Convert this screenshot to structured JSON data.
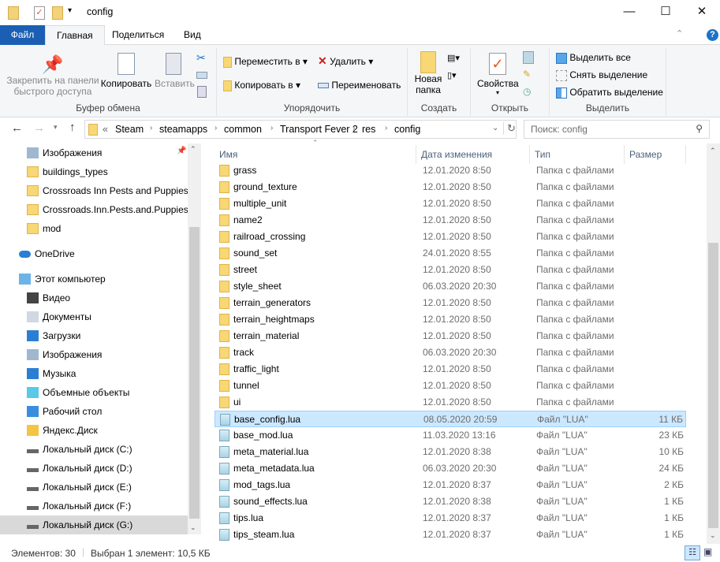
{
  "window": {
    "title": "config",
    "minimize": "—",
    "maximize": "☐",
    "close": "✕"
  },
  "tabs": [
    "Файл",
    "Главная",
    "Поделиться",
    "Вид"
  ],
  "ribbon": {
    "clipboard": {
      "pin": "Закрепить на панели быстрого доступа",
      "pin1": "Закрепить на панели",
      "pin2": "быстрого доступа",
      "copy": "Копировать",
      "paste": "Вставить",
      "label": "Буфер обмена"
    },
    "organize": {
      "move": "Переместить в",
      "copy_to": "Копировать в",
      "delete": "Удалить",
      "rename": "Переименовать",
      "label": "Упорядочить"
    },
    "create": {
      "new1": "Новая",
      "new2": "папка",
      "label": "Создать"
    },
    "open": {
      "props": "Свойства",
      "label": "Открыть"
    },
    "select": {
      "all": "Выделить все",
      "none": "Снять выделение",
      "invert": "Обратить выделение",
      "label": "Выделить"
    }
  },
  "address": {
    "overflow": "«",
    "crumbs": [
      "Steam",
      "steamapps",
      "common",
      "Transport Fever 2",
      "res",
      "config"
    ],
    "search_placeholder": "Поиск: config"
  },
  "nav": [
    {
      "label": "Изображения",
      "icon": "pictures"
    },
    {
      "label": "buildings_types",
      "icon": "folder"
    },
    {
      "label": "Crossroads Inn Pests and Puppies",
      "icon": "folder"
    },
    {
      "label": "Crossroads.Inn.Pests.and.Puppies-CODEX",
      "icon": "folder"
    },
    {
      "label": "mod",
      "icon": "folder"
    },
    {
      "label": "OneDrive",
      "icon": "cloud"
    },
    {
      "label": "Этот компьютер",
      "icon": "computer"
    },
    {
      "label": "Видео",
      "icon": "video"
    },
    {
      "label": "Документы",
      "icon": "documents"
    },
    {
      "label": "Загрузки",
      "icon": "downloads"
    },
    {
      "label": "Изображения",
      "icon": "pictures"
    },
    {
      "label": "Музыка",
      "icon": "music"
    },
    {
      "label": "Объемные объекты",
      "icon": "3d"
    },
    {
      "label": "Рабочий стол",
      "icon": "desktop"
    },
    {
      "label": "Яндекс.Диск",
      "icon": "yadisk"
    },
    {
      "label": "Локальный диск (C:)",
      "icon": "drive"
    },
    {
      "label": "Локальный диск (D:)",
      "icon": "drive"
    },
    {
      "label": "Локальный диск (E:)",
      "icon": "drive"
    },
    {
      "label": "Локальный диск (F:)",
      "icon": "drive"
    },
    {
      "label": "Локальный диск (G:)",
      "icon": "drive",
      "selected": true
    }
  ],
  "columns": [
    "Имя",
    "Дата изменения",
    "Тип",
    "Размер"
  ],
  "files": [
    {
      "name": "grass",
      "date": "12.01.2020 8:50",
      "type": "Папка с файлами",
      "size": ""
    },
    {
      "name": "ground_texture",
      "date": "12.01.2020 8:50",
      "type": "Папка с файлами",
      "size": ""
    },
    {
      "name": "multiple_unit",
      "date": "12.01.2020 8:50",
      "type": "Папка с файлами",
      "size": ""
    },
    {
      "name": "name2",
      "date": "12.01.2020 8:50",
      "type": "Папка с файлами",
      "size": ""
    },
    {
      "name": "railroad_crossing",
      "date": "12.01.2020 8:50",
      "type": "Папка с файлами",
      "size": ""
    },
    {
      "name": "sound_set",
      "date": "24.01.2020 8:55",
      "type": "Папка с файлами",
      "size": ""
    },
    {
      "name": "street",
      "date": "12.01.2020 8:50",
      "type": "Папка с файлами",
      "size": ""
    },
    {
      "name": "style_sheet",
      "date": "06.03.2020 20:30",
      "type": "Папка с файлами",
      "size": ""
    },
    {
      "name": "terrain_generators",
      "date": "12.01.2020 8:50",
      "type": "Папка с файлами",
      "size": ""
    },
    {
      "name": "terrain_heightmaps",
      "date": "12.01.2020 8:50",
      "type": "Папка с файлами",
      "size": ""
    },
    {
      "name": "terrain_material",
      "date": "12.01.2020 8:50",
      "type": "Папка с файлами",
      "size": ""
    },
    {
      "name": "track",
      "date": "06.03.2020 20:30",
      "type": "Папка с файлами",
      "size": ""
    },
    {
      "name": "traffic_light",
      "date": "12.01.2020 8:50",
      "type": "Папка с файлами",
      "size": ""
    },
    {
      "name": "tunnel",
      "date": "12.01.2020 8:50",
      "type": "Папка с файлами",
      "size": ""
    },
    {
      "name": "ui",
      "date": "12.01.2020 8:50",
      "type": "Папка с файлами",
      "size": ""
    },
    {
      "name": "base_config.lua",
      "date": "08.05.2020 20:59",
      "type": "Файл \"LUA\"",
      "size": "11 КБ",
      "selected": true
    },
    {
      "name": "base_mod.lua",
      "date": "11.03.2020 13:16",
      "type": "Файл \"LUA\"",
      "size": "23 КБ"
    },
    {
      "name": "meta_material.lua",
      "date": "12.01.2020 8:38",
      "type": "Файл \"LUA\"",
      "size": "10 КБ"
    },
    {
      "name": "meta_metadata.lua",
      "date": "06.03.2020 20:30",
      "type": "Файл \"LUA\"",
      "size": "24 КБ"
    },
    {
      "name": "mod_tags.lua",
      "date": "12.01.2020 8:37",
      "type": "Файл \"LUA\"",
      "size": "2 КБ"
    },
    {
      "name": "sound_effects.lua",
      "date": "12.01.2020 8:38",
      "type": "Файл \"LUA\"",
      "size": "1 КБ"
    },
    {
      "name": "tips.lua",
      "date": "12.01.2020 8:37",
      "type": "Файл \"LUA\"",
      "size": "1 КБ"
    },
    {
      "name": "tips_steam.lua",
      "date": "12.01.2020 8:37",
      "type": "Файл \"LUA\"",
      "size": "1 КБ"
    }
  ],
  "status": {
    "count": "Элементов: 30",
    "selection": "Выбран 1 элемент: 10,5 КБ"
  },
  "colors": {
    "accent": "#1a5fb4",
    "selection": "#cce8ff"
  }
}
